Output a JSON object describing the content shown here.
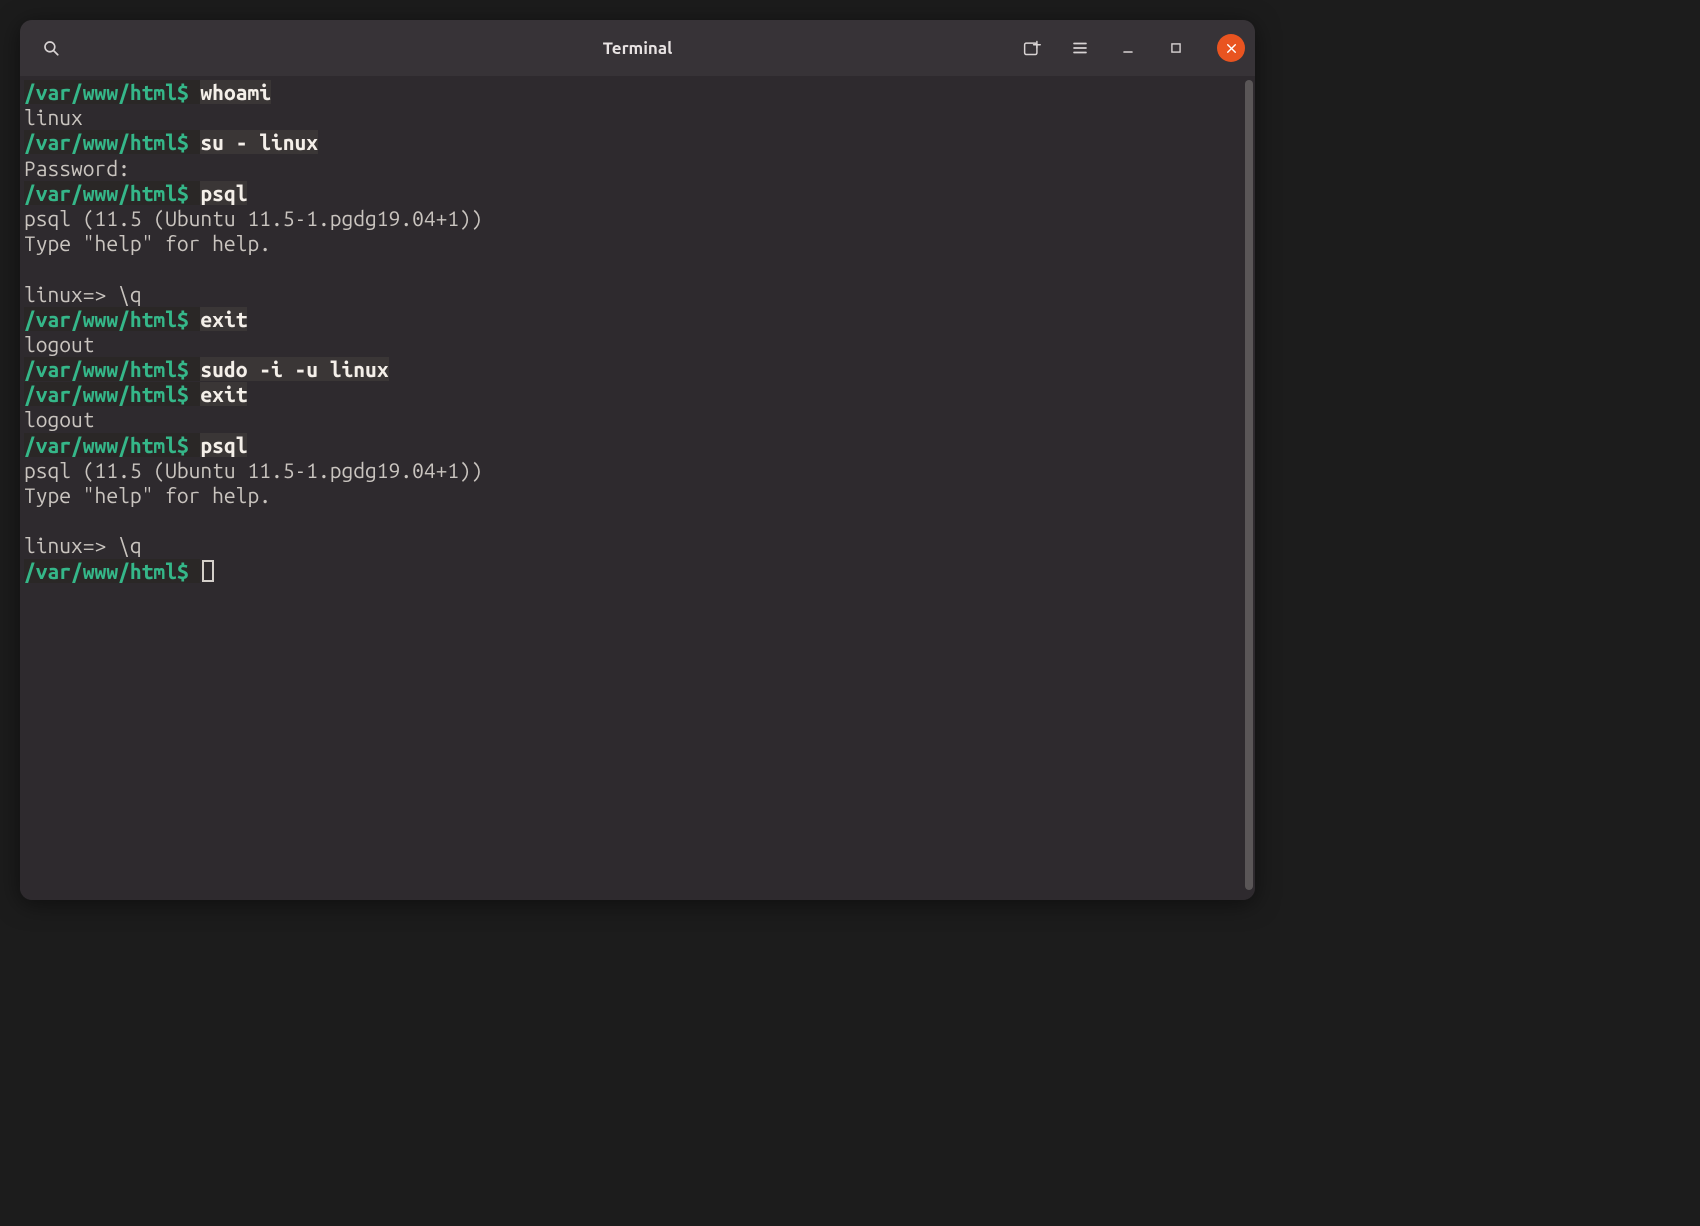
{
  "titlebar": {
    "title": "Terminal"
  },
  "colors": {
    "accent": "#e95420",
    "prompt": "#35b789",
    "bg": "#2e2a2e"
  },
  "lines": [
    {
      "type": "prompt",
      "path": "/var/www/html",
      "sep": "$ ",
      "cmd": "whoami"
    },
    {
      "type": "out",
      "text": "linux"
    },
    {
      "type": "prompt",
      "path": "/var/www/html",
      "sep": "$ ",
      "cmd": "su - linux"
    },
    {
      "type": "out",
      "text": "Password:"
    },
    {
      "type": "prompt",
      "path": "/var/www/html",
      "sep": "$ ",
      "cmd": "psql"
    },
    {
      "type": "out",
      "text": "psql (11.5 (Ubuntu 11.5-1.pgdg19.04+1))"
    },
    {
      "type": "out",
      "text": "Type \"help\" for help."
    },
    {
      "type": "blank"
    },
    {
      "type": "psql",
      "prompt": "linux=> ",
      "cmd": "\\q"
    },
    {
      "type": "prompt",
      "path": "/var/www/html",
      "sep": "$ ",
      "cmd": "exit"
    },
    {
      "type": "out",
      "text": "logout"
    },
    {
      "type": "prompt",
      "path": "/var/www/html",
      "sep": "$ ",
      "cmd": "sudo -i -u linux"
    },
    {
      "type": "prompt",
      "path": "/var/www/html",
      "sep": "$ ",
      "cmd": "exit"
    },
    {
      "type": "out",
      "text": "logout"
    },
    {
      "type": "prompt",
      "path": "/var/www/html",
      "sep": "$ ",
      "cmd": "psql"
    },
    {
      "type": "out",
      "text": "psql (11.5 (Ubuntu 11.5-1.pgdg19.04+1))"
    },
    {
      "type": "out",
      "text": "Type \"help\" for help."
    },
    {
      "type": "blank"
    },
    {
      "type": "psql",
      "prompt": "linux=> ",
      "cmd": "\\q"
    },
    {
      "type": "prompt-cursor",
      "path": "/var/www/html",
      "sep": "$ "
    }
  ]
}
